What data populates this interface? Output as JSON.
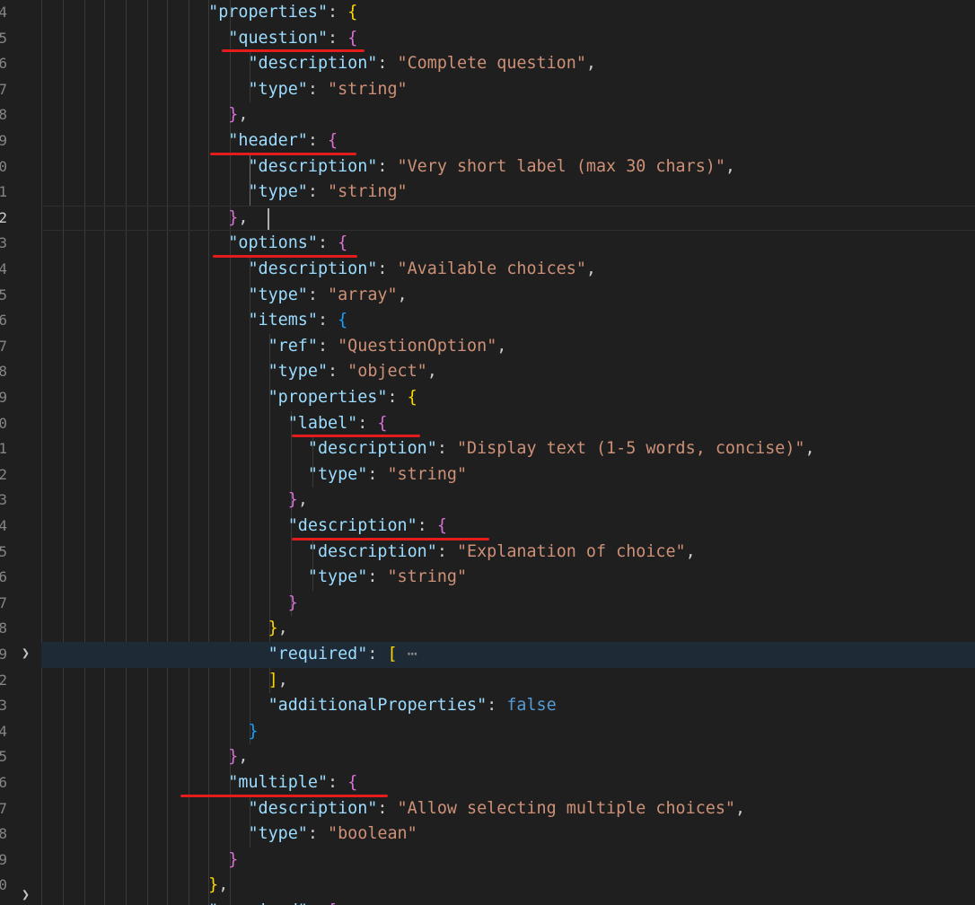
{
  "editor": {
    "language": "json",
    "line_numbers": [
      "4",
      "5",
      "6",
      "7",
      "8",
      "9",
      "0",
      "1",
      "2",
      "3",
      "4",
      "5",
      "6",
      "7",
      "8",
      "9",
      "0",
      "1",
      "2",
      "3",
      "4",
      "5",
      "6",
      "7",
      "8",
      "9",
      "2",
      "3",
      "4",
      "5",
      "6",
      "7",
      "8",
      "9",
      "0"
    ],
    "current_line_number": "2",
    "folded_line_ellipsis": "⋯",
    "lines": [
      [
        [
          "p",
          "  "
        ],
        [
          "k",
          "\"properties\""
        ],
        [
          "p",
          ": "
        ],
        [
          "b1",
          "{"
        ]
      ],
      [
        [
          "p",
          "    "
        ],
        [
          "k",
          "\"question\""
        ],
        [
          "p",
          ": "
        ],
        [
          "b2",
          "{"
        ]
      ],
      [
        [
          "p",
          "      "
        ],
        [
          "k",
          "\"description\""
        ],
        [
          "p",
          ": "
        ],
        [
          "s",
          "\"Complete question\""
        ],
        [
          "p",
          ","
        ]
      ],
      [
        [
          "p",
          "      "
        ],
        [
          "k",
          "\"type\""
        ],
        [
          "p",
          ": "
        ],
        [
          "s",
          "\"string\""
        ]
      ],
      [
        [
          "p",
          "    "
        ],
        [
          "b2",
          "}"
        ],
        [
          "p",
          ","
        ]
      ],
      [
        [
          "p",
          "    "
        ],
        [
          "k",
          "\"header\""
        ],
        [
          "p",
          ": "
        ],
        [
          "b2",
          "{"
        ]
      ],
      [
        [
          "p",
          "      "
        ],
        [
          "k",
          "\"description\""
        ],
        [
          "p",
          ": "
        ],
        [
          "s",
          "\"Very short label (max 30 chars)\""
        ],
        [
          "p",
          ","
        ]
      ],
      [
        [
          "p",
          "      "
        ],
        [
          "k",
          "\"type\""
        ],
        [
          "p",
          ": "
        ],
        [
          "s",
          "\"string\""
        ]
      ],
      [
        [
          "p",
          "    "
        ],
        [
          "b2",
          "}"
        ],
        [
          "p",
          ","
        ]
      ],
      [
        [
          "p",
          "    "
        ],
        [
          "k",
          "\"options\""
        ],
        [
          "p",
          ": "
        ],
        [
          "b2",
          "{"
        ]
      ],
      [
        [
          "p",
          "      "
        ],
        [
          "k",
          "\"description\""
        ],
        [
          "p",
          ": "
        ],
        [
          "s",
          "\"Available choices\""
        ],
        [
          "p",
          ","
        ]
      ],
      [
        [
          "p",
          "      "
        ],
        [
          "k",
          "\"type\""
        ],
        [
          "p",
          ": "
        ],
        [
          "s",
          "\"array\""
        ],
        [
          "p",
          ","
        ]
      ],
      [
        [
          "p",
          "      "
        ],
        [
          "k",
          "\"items\""
        ],
        [
          "p",
          ": "
        ],
        [
          "b3",
          "{"
        ]
      ],
      [
        [
          "p",
          "        "
        ],
        [
          "k",
          "\"ref\""
        ],
        [
          "p",
          ": "
        ],
        [
          "s",
          "\"QuestionOption\""
        ],
        [
          "p",
          ","
        ]
      ],
      [
        [
          "p",
          "        "
        ],
        [
          "k",
          "\"type\""
        ],
        [
          "p",
          ": "
        ],
        [
          "s",
          "\"object\""
        ],
        [
          "p",
          ","
        ]
      ],
      [
        [
          "p",
          "        "
        ],
        [
          "k",
          "\"properties\""
        ],
        [
          "p",
          ": "
        ],
        [
          "b1",
          "{"
        ]
      ],
      [
        [
          "p",
          "          "
        ],
        [
          "k",
          "\"label\""
        ],
        [
          "p",
          ": "
        ],
        [
          "b2",
          "{"
        ]
      ],
      [
        [
          "p",
          "            "
        ],
        [
          "k",
          "\"description\""
        ],
        [
          "p",
          ": "
        ],
        [
          "s",
          "\"Display text (1-5 words, concise)\""
        ],
        [
          "p",
          ","
        ]
      ],
      [
        [
          "p",
          "            "
        ],
        [
          "k",
          "\"type\""
        ],
        [
          "p",
          ": "
        ],
        [
          "s",
          "\"string\""
        ]
      ],
      [
        [
          "p",
          "          "
        ],
        [
          "b2",
          "}"
        ],
        [
          "p",
          ","
        ]
      ],
      [
        [
          "p",
          "          "
        ],
        [
          "k",
          "\"description\""
        ],
        [
          "p",
          ": "
        ],
        [
          "b2",
          "{"
        ]
      ],
      [
        [
          "p",
          "            "
        ],
        [
          "k",
          "\"description\""
        ],
        [
          "p",
          ": "
        ],
        [
          "s",
          "\"Explanation of choice\""
        ],
        [
          "p",
          ","
        ]
      ],
      [
        [
          "p",
          "            "
        ],
        [
          "k",
          "\"type\""
        ],
        [
          "p",
          ": "
        ],
        [
          "s",
          "\"string\""
        ]
      ],
      [
        [
          "p",
          "          "
        ],
        [
          "b2",
          "}"
        ]
      ],
      [
        [
          "p",
          "        "
        ],
        [
          "b1",
          "}"
        ],
        [
          "p",
          ","
        ]
      ],
      [
        [
          "p",
          "        "
        ],
        [
          "k",
          "\"required\""
        ],
        [
          "p",
          ": "
        ],
        [
          "b1",
          "["
        ],
        [
          "ell",
          " ⋯"
        ]
      ],
      [
        [
          "p",
          "        "
        ],
        [
          "b1",
          "]"
        ],
        [
          "p",
          ","
        ]
      ],
      [
        [
          "p",
          "        "
        ],
        [
          "k",
          "\"additionalProperties\""
        ],
        [
          "p",
          ": "
        ],
        [
          "kw",
          "false"
        ]
      ],
      [
        [
          "p",
          "      "
        ],
        [
          "b3",
          "}"
        ]
      ],
      [
        [
          "p",
          "    "
        ],
        [
          "b2",
          "}"
        ],
        [
          "p",
          ","
        ]
      ],
      [
        [
          "p",
          "    "
        ],
        [
          "k",
          "\"multiple\""
        ],
        [
          "p",
          ": "
        ],
        [
          "b2",
          "{"
        ]
      ],
      [
        [
          "p",
          "      "
        ],
        [
          "k",
          "\"description\""
        ],
        [
          "p",
          ": "
        ],
        [
          "s",
          "\"Allow selecting multiple choices\""
        ],
        [
          "p",
          ","
        ]
      ],
      [
        [
          "p",
          "      "
        ],
        [
          "k",
          "\"type\""
        ],
        [
          "p",
          ": "
        ],
        [
          "s",
          "\"boolean\""
        ]
      ],
      [
        [
          "p",
          "    "
        ],
        [
          "b2",
          "}"
        ]
      ],
      [
        [
          "p",
          "  "
        ],
        [
          "b1",
          "}"
        ],
        [
          "p",
          ","
        ]
      ],
      [
        [
          "p",
          "  "
        ],
        [
          "k",
          "\"required\""
        ],
        [
          "p",
          ": "
        ],
        [
          "b2",
          "["
        ]
      ]
    ]
  }
}
